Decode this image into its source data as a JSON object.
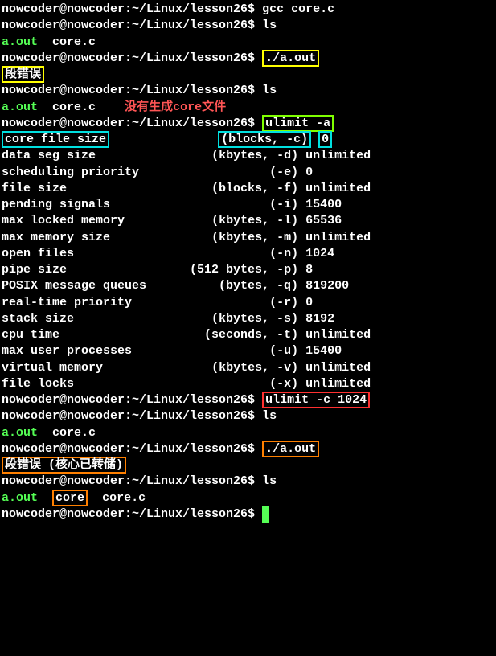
{
  "prompt": "nowcoder@nowcoder:~/Linux/lesson26$ ",
  "cmd": {
    "gcc": "gcc core.c",
    "ls": "ls",
    "run": "./a.out",
    "ulimit_a": "ulimit -a",
    "ulimit_c": "ulimit -c 1024"
  },
  "out": {
    "aout": "a.out",
    "corec": "core.c",
    "core": "core",
    "segfault1": "段错误",
    "segfault2": "段错误 (核心已转储)"
  },
  "annotation": {
    "no_core": "没有生成core文件"
  },
  "ulimit_rows": [
    {
      "label": "core file size",
      "spec": "(blocks, -c)",
      "value": "0"
    },
    {
      "label": "data seg size",
      "spec": "(kbytes, -d)",
      "value": "unlimited"
    },
    {
      "label": "scheduling priority",
      "spec": "(-e)",
      "value": "0"
    },
    {
      "label": "file size",
      "spec": "(blocks, -f)",
      "value": "unlimited"
    },
    {
      "label": "pending signals",
      "spec": "(-i)",
      "value": "15400"
    },
    {
      "label": "max locked memory",
      "spec": "(kbytes, -l)",
      "value": "65536"
    },
    {
      "label": "max memory size",
      "spec": "(kbytes, -m)",
      "value": "unlimited"
    },
    {
      "label": "open files",
      "spec": "(-n)",
      "value": "1024"
    },
    {
      "label": "pipe size",
      "spec": "(512 bytes, -p)",
      "value": "8"
    },
    {
      "label": "POSIX message queues",
      "spec": "(bytes, -q)",
      "value": "819200"
    },
    {
      "label": "real-time priority",
      "spec": "(-r)",
      "value": "0"
    },
    {
      "label": "stack size",
      "spec": "(kbytes, -s)",
      "value": "8192"
    },
    {
      "label": "cpu time",
      "spec": "(seconds, -t)",
      "value": "unlimited"
    },
    {
      "label": "max user processes",
      "spec": "(-u)",
      "value": "15400"
    },
    {
      "label": "virtual memory",
      "spec": "(kbytes, -v)",
      "value": "unlimited"
    },
    {
      "label": "file locks",
      "spec": "(-x)",
      "value": "unlimited"
    }
  ]
}
